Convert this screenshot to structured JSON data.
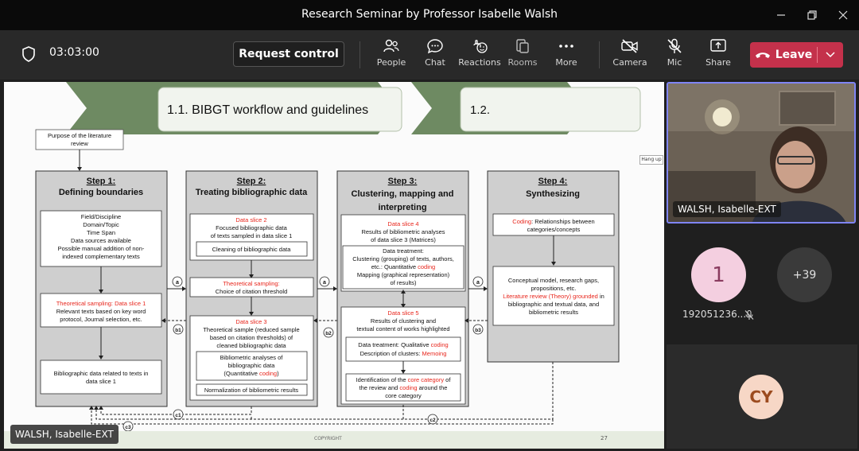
{
  "window": {
    "title": "Research Seminar by Professor Isabelle Walsh"
  },
  "toolbar": {
    "timer": "03:03:00",
    "request_control": "Request control",
    "people": "People",
    "chat": "Chat",
    "reactions": "Reactions",
    "rooms": "Rooms",
    "more": "More",
    "camera": "Camera",
    "mic": "Mic",
    "share": "Share",
    "leave": "Leave"
  },
  "colors": {
    "leave": "#c4314b",
    "accent": "#7f85f5",
    "slide_red": "#e8261c",
    "slide_green": "#6e8a62"
  },
  "slide": {
    "header1": "1.1. BIBGT workflow and guidelines",
    "header2": "1.2.",
    "purpose": [
      "Purpose of the literature",
      "review"
    ],
    "hangup": "Hang up",
    "copyright": "COPYRIGHT",
    "page": "27",
    "step1": {
      "title": "Step 1:",
      "subtitle": "Defining boundaries",
      "box1": [
        "Field/Discipline",
        "Domain/Topic",
        "Time Span",
        "Data sources available",
        "Possible manual addition of non-",
        "indexed complementary texts"
      ],
      "box2_red": "Theoretical sampling: Data slice 1",
      "box2": [
        "Relevant texts based on key word",
        "protocol, Journal selection, etc."
      ],
      "box3": [
        "Bibliographic data related to texts in",
        "data slice 1"
      ]
    },
    "step2": {
      "title": "Step 2:",
      "subtitle": "Treating bibliographic data",
      "box1_red": "Data slice 2",
      "box1": [
        "Focused bibliographic data",
        "of texts sampled in data slice 1"
      ],
      "box1_inner": "Cleaning of bibliographic data",
      "box2_red": "Theoretical sampling:",
      "box2": "Choice of citation threshold",
      "box3_red": "Data slice 3",
      "box3": [
        "Theoretical sample (reduced sample",
        "based on citation thresholds) of",
        "cleaned bibliographic data"
      ],
      "box3_inner": [
        "Bibliometric analyses of",
        "bibliographic data"
      ],
      "box3_inner_q": "(Quantitative ",
      "box3_inner_q_red": "coding",
      "box3_inner_q_end": ")",
      "box4": "Normalization of bibliometric results"
    },
    "step3": {
      "title": "Step 3:",
      "subtitle1": "Clustering, mapping and",
      "subtitle2": "interpreting",
      "box1_red": "Data slice 4",
      "box1": [
        "Results of bibliometric analyses",
        "of data slice 3 (Matrices)"
      ],
      "box1_inner": [
        "Data treatment:",
        "Clustering (grouping) of texts, authors,"
      ],
      "box1_inner_q": "etc.: Quantitative ",
      "box1_inner_q_red": "coding",
      "box1_inner2": [
        "Mapping (graphical representation)",
        "of results)"
      ],
      "box2_red": "Data slice 5",
      "box2": [
        "Results of clustering and",
        "textual content of works highlighted"
      ],
      "box2_inner1a": "Data treatment: Qualitative ",
      "box2_inner1a_red": "coding",
      "box2_inner1b": "Description of clusters: ",
      "box2_inner1b_red": "Memoing",
      "box2_inner2a": "Identification of the ",
      "box2_inner2a_red": "core category",
      "box2_inner2a_end": " of",
      "box2_inner2b": "the review and ",
      "box2_inner2b_red": "coding",
      "box2_inner2b_end": " around the",
      "box2_inner2c": "core category"
    },
    "step4": {
      "title": "Step 4:",
      "subtitle": "Synthesizing",
      "box1_red": "Coding",
      "box1a": ": Relationships between",
      "box1b": "categories/concepts",
      "box2": [
        "Conceptual model, research gaps,",
        "propositions, etc."
      ],
      "box2_red": "Literature review (Theory) grounded",
      "box2_red_end": " in",
      "box2b": [
        "bibliographic and textual data, and",
        "bibliometric results"
      ]
    },
    "labels": {
      "a": "a",
      "b1": "b1",
      "b2": "b2",
      "b3": "b3",
      "c1": "c1",
      "c2": "c2",
      "c3": "c3"
    }
  },
  "presenter": {
    "name_tag": "WALSH, Isabelle-EXT"
  },
  "participants": {
    "self_video_name": "WALSH, Isabelle-EXT",
    "avatar1": "1",
    "avatar1_name": "192051236...",
    "more_count": "+39",
    "avatar_cy": "CY"
  }
}
